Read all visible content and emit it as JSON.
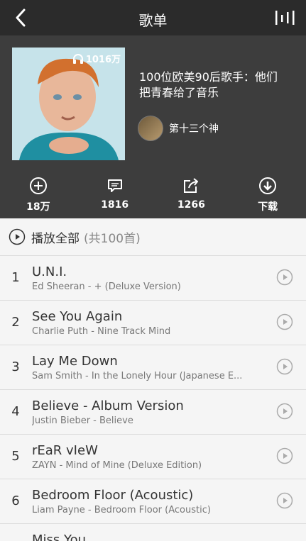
{
  "header": {
    "title": "歌单"
  },
  "playlist": {
    "title": "100位欧美90后歌手：他们把青春给了音乐",
    "play_count": "1016万",
    "creator": "第十三个神"
  },
  "actions": [
    {
      "icon": "add-circle-icon",
      "label": "18万"
    },
    {
      "icon": "comment-icon",
      "label": "1816"
    },
    {
      "icon": "share-icon",
      "label": "1266"
    },
    {
      "icon": "download-icon",
      "label": "下载"
    }
  ],
  "play_all": {
    "label": "播放全部",
    "count": "(共100首)"
  },
  "songs": [
    {
      "num": "1",
      "title": "U.N.I.",
      "meta": "Ed Sheeran - + (Deluxe Version)"
    },
    {
      "num": "2",
      "title": "See You Again",
      "meta": "Charlie Puth - Nine Track Mind"
    },
    {
      "num": "3",
      "title": "Lay Me Down",
      "meta": "Sam Smith - In the Lonely Hour (Japanese E..."
    },
    {
      "num": "4",
      "title": "Believe - Album Version",
      "meta": "Justin Bieber - Believe"
    },
    {
      "num": "5",
      "title": "rEaR vIeW",
      "meta": "ZAYN - Mind of Mine (Deluxe Edition)"
    },
    {
      "num": "6",
      "title": "Bedroom Floor (Acoustic)",
      "meta": "Liam Payne - Bedroom Floor (Acoustic)"
    },
    {
      "num": "",
      "title": "Miss You",
      "meta": ""
    }
  ]
}
